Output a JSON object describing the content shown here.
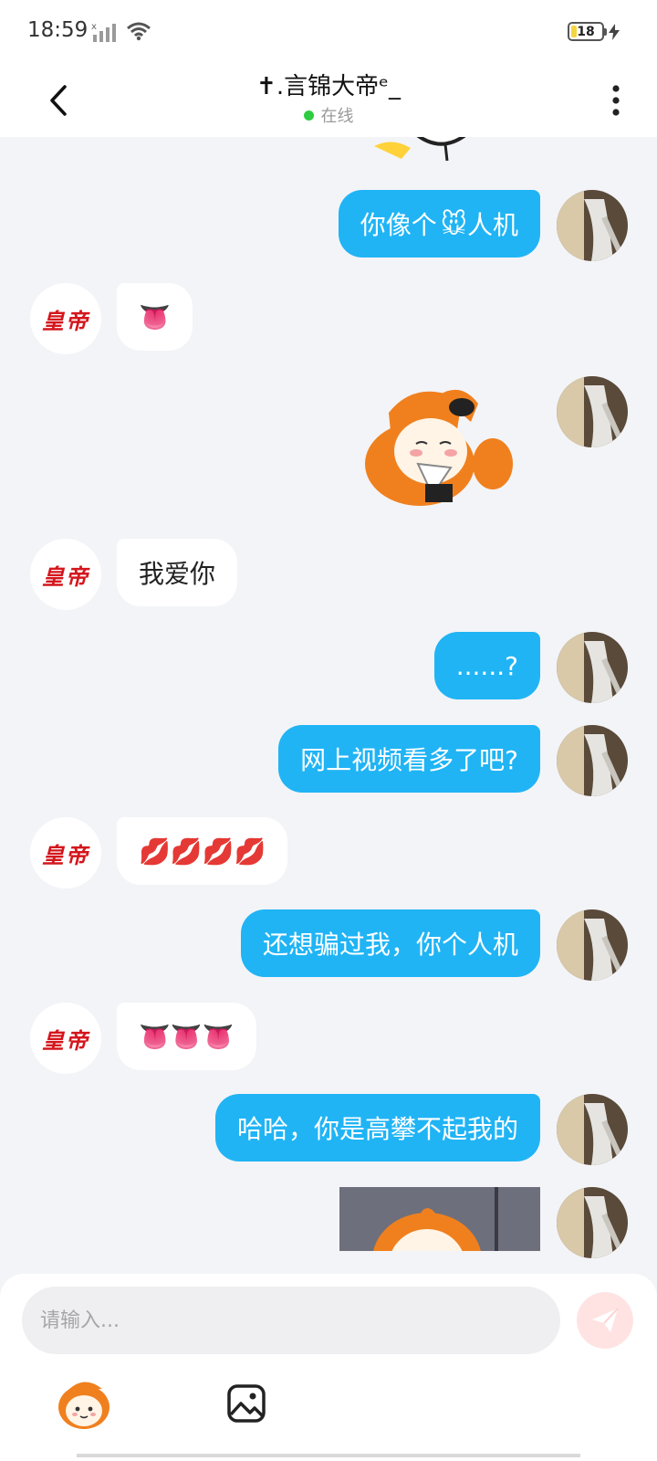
{
  "status_bar": {
    "time": "18:59",
    "battery": "18",
    "icons": [
      "signal-icon",
      "wifi-icon",
      "battery-icon",
      "charging-bolt-icon"
    ]
  },
  "header": {
    "title": "✝.言锦大帝ᵉ_",
    "presence": "在线",
    "icons": [
      "back-arrow-icon",
      "more-vert-icon"
    ]
  },
  "messages": [
    {
      "side": "out",
      "type": "text",
      "text": "你像个",
      "emoji": "🐭",
      "text_after": "人机"
    },
    {
      "side": "in",
      "type": "emoji",
      "text": "👅"
    },
    {
      "side": "out",
      "type": "sticker",
      "sticker": "crying-fox-girl-sticker"
    },
    {
      "side": "in",
      "type": "text",
      "text": "我爱你"
    },
    {
      "side": "out",
      "type": "text",
      "text": "......?"
    },
    {
      "side": "out",
      "type": "text",
      "text": "网上视频看多了吧?"
    },
    {
      "side": "in",
      "type": "emoji",
      "text": "💋💋💋💋"
    },
    {
      "side": "out",
      "type": "text",
      "text": "还想骗过我，你个人机"
    },
    {
      "side": "in",
      "type": "emoji",
      "text": "👅👅👅"
    },
    {
      "side": "out",
      "type": "text",
      "text": "哈哈，你是高攀不起我的"
    },
    {
      "side": "out",
      "type": "sticker",
      "sticker": "fox-girl-sticker"
    }
  ],
  "contact_avatar_text": "皇帝",
  "composer": {
    "placeholder": "请输入...",
    "icons": [
      "send-icon",
      "sticker-icon",
      "image-icon"
    ]
  },
  "colors": {
    "outgoing_bubble": "#20b4f5",
    "incoming_bubble": "#ffffff",
    "background": "#f3f4f7",
    "online": "#2ecc40",
    "avatar_text": "#d4161d"
  }
}
